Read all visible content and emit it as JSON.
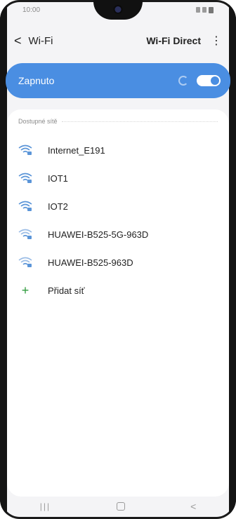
{
  "status_bar": {
    "time": "10:00"
  },
  "header": {
    "title": "Wi-Fi",
    "wifi_direct_label": "Wi-Fi Direct",
    "more_label": "⋮"
  },
  "toggle": {
    "label": "Zapnuto",
    "state": "on"
  },
  "available_networks": {
    "title": "Dostupné sítě",
    "items": [
      {
        "name": "Internet_E191",
        "icon": "wifi-locked-icon"
      },
      {
        "name": "IOT1",
        "icon": "wifi-locked-icon"
      },
      {
        "name": "IOT2",
        "icon": "wifi-locked-icon"
      },
      {
        "name": "HUAWEI-B525-5G-963D",
        "icon": "wifi-locked-icon"
      },
      {
        "name": "HUAWEI-B525-963D",
        "icon": "wifi-locked-icon"
      }
    ],
    "add_network_label": "Přidat síť"
  },
  "colors": {
    "accent": "#4a8ee2",
    "wifi_icon": "#5b95d8",
    "add_icon": "#2e9a3c"
  }
}
